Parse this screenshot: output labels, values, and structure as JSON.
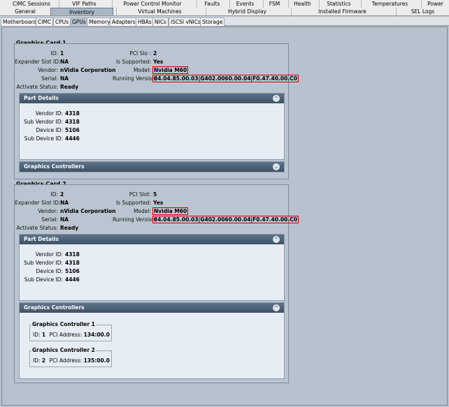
{
  "top_tabs_row1": [
    "CIMC Sessions",
    "VIF Paths",
    "Power Control Monitor",
    "Faults",
    "Events",
    "FSM",
    "Health",
    "Statistics",
    "Temperatures",
    "Power"
  ],
  "top_tabs_row2": [
    "General",
    "Inventory",
    "Virtual Machines",
    "Hybrid Display",
    "Installed Firmware",
    "SEL Logs"
  ],
  "active_top_tab": "Inventory",
  "sub_tabs": [
    "Motherboard",
    "CIMC",
    "CPUs",
    "GPUs",
    "Memory",
    "Adapters",
    "HBAs",
    "NICs",
    "iSCSI vNICs",
    "Storage"
  ],
  "active_sub_tab": "GPUs",
  "cards": [
    {
      "title": "Graphics Card 1",
      "left": [
        {
          "k": "ID:",
          "v": "1"
        },
        {
          "k": "Expander Slot ID:",
          "v": "NA"
        },
        {
          "k": "Vendor:",
          "v": "nVidia Corporation"
        },
        {
          "k": "Serial:",
          "v": "NA"
        },
        {
          "k": "Activate Status:",
          "v": "Ready"
        }
      ],
      "pci_label": "PCI Slo :",
      "pci_value": "2",
      "supported_label": "Is Supported:",
      "supported_value": "Yes",
      "model_label": "Model:",
      "model_value": "Nvidia M60",
      "running_label": "Running Version:",
      "running_value": "84.04.85.00.03|G402.0060.00.04|F0.47.40.00.C0",
      "part_details_title": "Part Details",
      "part_details": [
        {
          "k": "Vendor ID:",
          "v": "4318"
        },
        {
          "k": "Sub Vendor ID:",
          "v": "4318"
        },
        {
          "k": "Device ID:",
          "v": "5106"
        },
        {
          "k": "Sub Device ID:",
          "v": "4446"
        }
      ],
      "controllers_title": "Graphics Controllers"
    },
    {
      "title": "Graphics Card 2",
      "left": [
        {
          "k": "ID:",
          "v": "2"
        },
        {
          "k": "Expander Slot ID:",
          "v": "NA"
        },
        {
          "k": "Vendor:",
          "v": "nVidia Corporation"
        },
        {
          "k": "Serial:",
          "v": "NA"
        },
        {
          "k": "Activate Status:",
          "v": "Ready"
        }
      ],
      "pci_label": "PCI Slot:",
      "pci_value": "5",
      "supported_label": "Is Supported:",
      "supported_value": "Yes",
      "model_label": "Model:",
      "model_value": "Nvidia M60",
      "running_label": "Running Version:",
      "running_value": "84.04.85.00.03|G402.0060.00.04|F0.47.40.00.C0",
      "part_details_title": "Part Details",
      "part_details": [
        {
          "k": "Vendor ID:",
          "v": "4318"
        },
        {
          "k": "Sub Vendor ID:",
          "v": "4318"
        },
        {
          "k": "Device ID:",
          "v": "5106"
        },
        {
          "k": "Sub Device ID:",
          "v": "4446"
        }
      ],
      "controllers_title": "Graphics Controllers",
      "controllers": [
        {
          "title": "Graphics Controller 1",
          "id_label": "ID:",
          "id": "1",
          "pci_label": "PCI Address:",
          "pci": "134:00.0"
        },
        {
          "title": "Graphics Controller 2",
          "id_label": "ID:",
          "id": "2",
          "pci_label": "PCI Address:",
          "pci": "135:00.0"
        }
      ]
    }
  ],
  "colors": {
    "highlight": "#d00000",
    "header": "#3e5266",
    "panel": "#bac5d1"
  },
  "icons": {
    "collapse": "chevron-up-icon",
    "expand": "chevron-down-icon"
  }
}
